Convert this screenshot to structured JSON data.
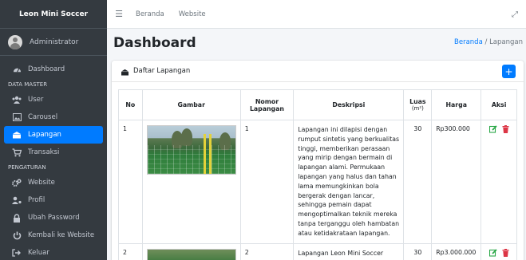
{
  "brand": {
    "name": "Leon Mini Soccer"
  },
  "user": {
    "name": "Administrator"
  },
  "sidebar": {
    "items": [
      {
        "label": "Dashboard",
        "icon": "dashboard-icon"
      },
      {
        "header": "DATA MASTER"
      },
      {
        "label": "User",
        "icon": "users-icon"
      },
      {
        "label": "Carousel",
        "icon": "image-icon"
      },
      {
        "label": "Lapangan",
        "icon": "field-icon",
        "active": true
      },
      {
        "label": "Transaksi",
        "icon": "cart-icon"
      },
      {
        "header": "PENGATURAN"
      },
      {
        "label": "Website",
        "icon": "cogs-icon"
      },
      {
        "label": "Profil",
        "icon": "user-cog-icon"
      },
      {
        "label": "Ubah Password",
        "icon": "lock-icon"
      },
      {
        "label": "Kembali ke Website",
        "icon": "power-icon"
      },
      {
        "label": "Keluar",
        "icon": "sign-out-icon"
      }
    ]
  },
  "topnav": {
    "links": [
      "Beranda",
      "Website"
    ]
  },
  "header": {
    "title": "Dashboard",
    "breadcrumb_home": "Beranda",
    "breadcrumb_sep": "/",
    "breadcrumb_current": "Lapangan"
  },
  "card": {
    "title": "Daftar Lapangan",
    "add_label": "+"
  },
  "table": {
    "headers": {
      "no": "No",
      "gambar": "Gambar",
      "nomor": "Nomor Lapangan",
      "deskripsi": "Deskripsi",
      "luas": "Luas",
      "luas_unit": "(m²)",
      "harga": "Harga",
      "aksi": "Aksi"
    },
    "rows": [
      {
        "no": "1",
        "nomor": "1",
        "deskripsi": "Lapangan ini dilapisi dengan rumput sintetis yang berkualitas tinggi, memberikan perasaan yang mirip dengan bermain di lapangan alami. Permukaan lapangan yang halus dan tahan lama memungkinkan bola bergerak dengan lancar, sehingga pemain dapat mengoptimalkan teknik mereka tanpa terganggu oleh hambatan atau ketidakrataan lapangan.",
        "luas": "30",
        "harga": "Rp300.000"
      },
      {
        "no": "2",
        "nomor": "2",
        "deskripsi": "Lapangan Leon Mini Soccer",
        "luas": "30",
        "harga": "Rp3.000.000"
      }
    ]
  },
  "colors": {
    "sidebar_bg": "#343a40",
    "active": "#007bff",
    "edit": "#28a745",
    "delete": "#dc3545"
  }
}
